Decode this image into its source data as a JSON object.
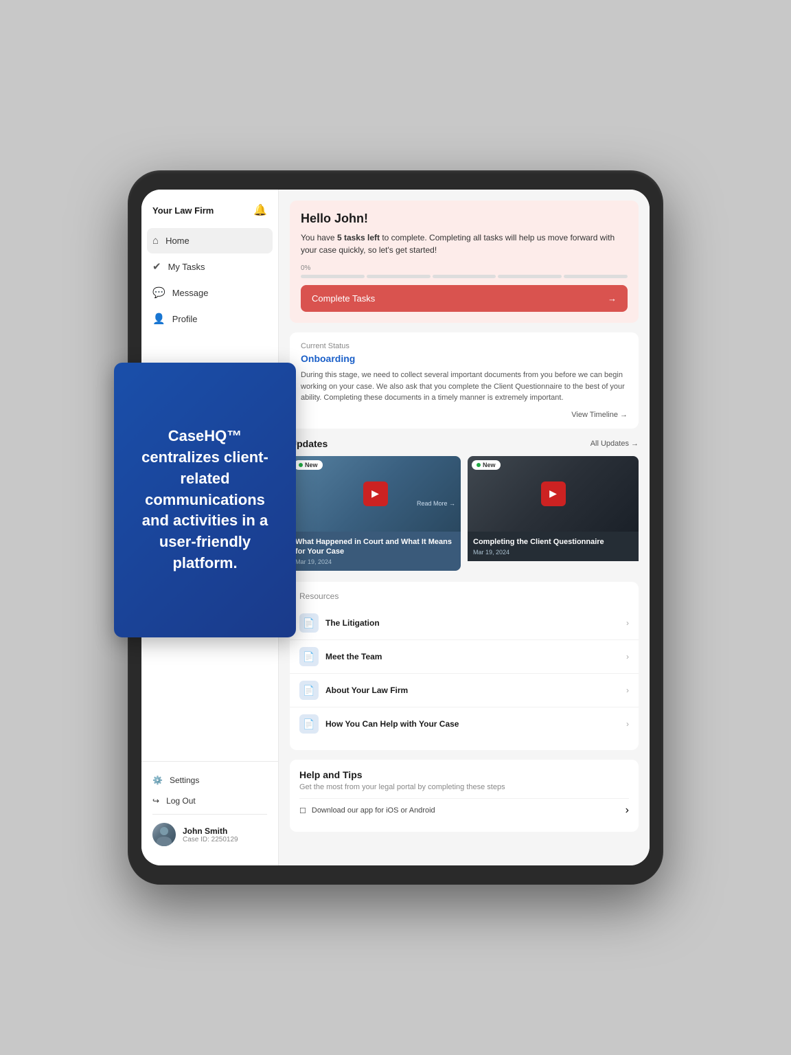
{
  "tablet": {
    "firm_name": "Your Law Firm"
  },
  "sidebar": {
    "title": "Your Law Firm",
    "nav_items": [
      {
        "id": "home",
        "label": "Home",
        "icon": "⌂",
        "active": true
      },
      {
        "id": "tasks",
        "label": "My Tasks",
        "icon": "✔",
        "active": false
      },
      {
        "id": "message",
        "label": "Message",
        "icon": "💬",
        "active": false
      },
      {
        "id": "profile",
        "label": "Profile",
        "icon": "👤",
        "active": false
      }
    ],
    "settings_label": "Settings",
    "logout_label": "Log Out",
    "user": {
      "name": "John Smith",
      "case_id": "Case ID: 2250129"
    }
  },
  "hello_card": {
    "title": "Hello John!",
    "text_before_bold": "You have ",
    "bold_text": "5 tasks left",
    "text_after_bold": " to complete. Completing all tasks will help us move forward with your case quickly, so let's get started!",
    "progress_label": "0%",
    "progress_segments": 5,
    "cta_label": "Complete Tasks",
    "cta_arrow": "→"
  },
  "status_card": {
    "label": "Current Status",
    "value": "Onboarding",
    "description": "During this stage, we need to collect several important documents from you before we can begin working on your case. We also ask that you complete the Client Questionnaire to the best of your ability. Completing these documents in a timely manner is extremely important.",
    "timeline_link": "View Timeline →"
  },
  "updates": {
    "title": "Updates",
    "all_link": "All Updates →",
    "items": [
      {
        "badge": "New",
        "title": "What Happened in Court and What It Means for Your Case",
        "date": "Mar 19, 2024",
        "read_more": "Read More →",
        "thumb_class": "thumb1"
      },
      {
        "badge": "New",
        "title": "Completing the Client Questionnaire",
        "date": "Mar 19, 2024",
        "thumb_class": "thumb2"
      }
    ]
  },
  "resources": {
    "title": "Resources",
    "items": [
      {
        "label": "The Litigation"
      },
      {
        "label": "Meet the Team"
      },
      {
        "label": "About Your Law Firm"
      },
      {
        "label": "How You Can Help with Your Case"
      }
    ]
  },
  "help": {
    "title": "Help and Tips",
    "subtitle": "Get the most from your legal portal by completing these steps",
    "items": [
      {
        "label": "Download our app for iOS or Android"
      }
    ]
  },
  "blue_overlay": {
    "text": "CaseHQ™ centralizes client-related communications and activities in a user-friendly platform."
  }
}
